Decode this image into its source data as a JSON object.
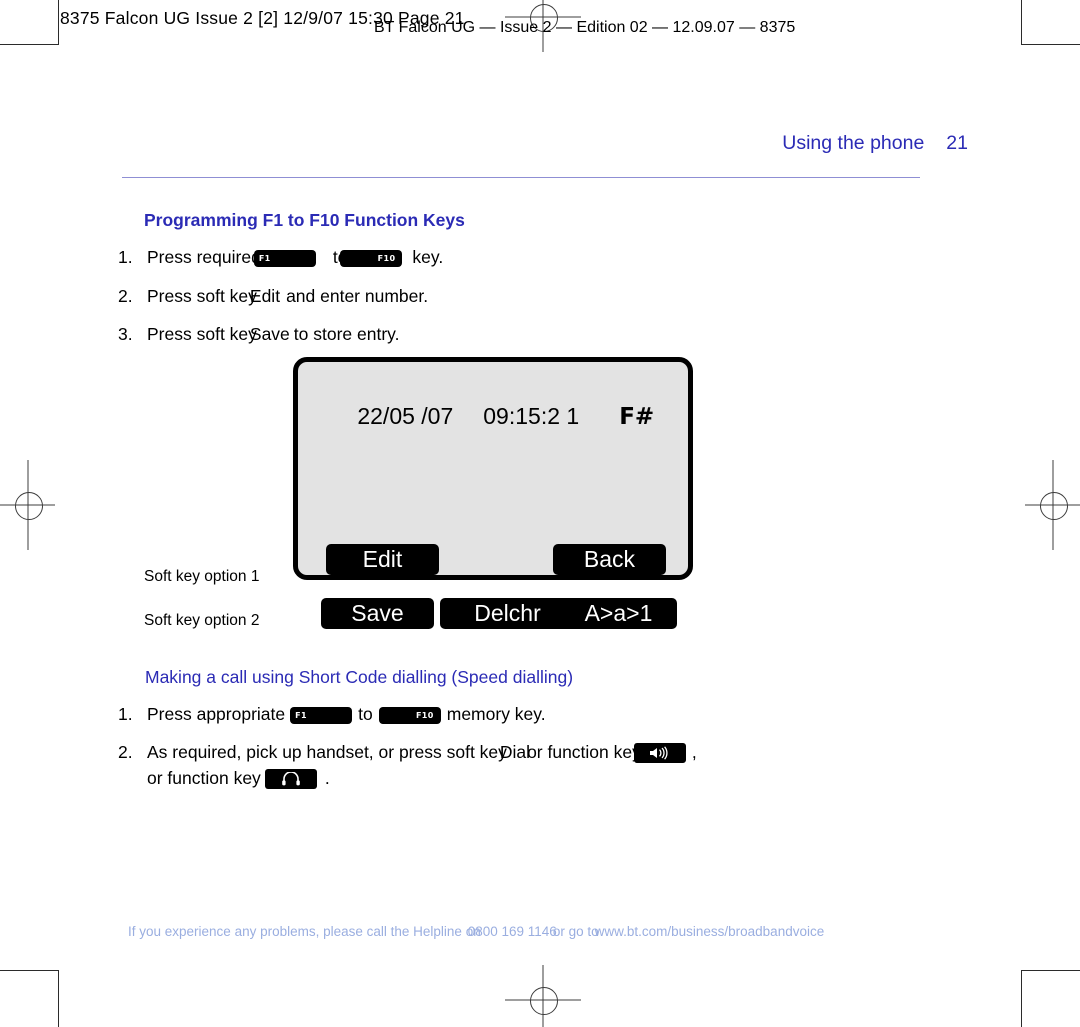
{
  "print_header": "8375 Falcon UG Issue 2 [2]  12/9/07  15:30  Page 21",
  "edition_line": "BT Falcon UG — Issue 2 — Edition 02 — 12.09.07 — 8375",
  "running_head": {
    "title": "Using the phone",
    "page_number": "21"
  },
  "headings": {
    "programming": "Programming F1 to F10 Function Keys",
    "short_code": "Making a call using Short Code dialling (Speed dialling)"
  },
  "steps_programming": [
    {
      "num": "1.",
      "text_a": "Press required",
      "key_1": "F1",
      "text_b": "to",
      "key_2": "F10",
      "text_c": "key."
    },
    {
      "num": "2.",
      "text_a": "Press soft key",
      "emph": "Edit",
      "text_b": "and enter number."
    },
    {
      "num": "3.",
      "text_a": "Press soft key",
      "emph": "Save",
      "text_b": "to store entry."
    }
  ],
  "steps_shortcode": [
    {
      "num": "1.",
      "text_a": "Press appropriate",
      "key_1": "F1",
      "text_b": "to",
      "key_2": "F10",
      "text_c": "memory key."
    },
    {
      "num": "2.",
      "text_a": "As required, pick up handset, or press soft key",
      "emph": "Dial",
      "text_b": "or function key",
      "icon_1": "loudspeaker-icon",
      "text_c": ",",
      "line2_a": "or function key",
      "icon_2": "headset-icon",
      "line2_b": "."
    }
  ],
  "phone_display": {
    "date": "22/05 /07",
    "time": "09:15:2 1",
    "flag": "F#",
    "softkeys_row1": [
      {
        "label": "Edit",
        "name": "softkey-edit"
      },
      {
        "label": "Back",
        "name": "softkey-back"
      }
    ],
    "softkeys_row2": [
      {
        "label": "Save",
        "name": "softkey-save"
      },
      {
        "label": "Delchr",
        "name": "softkey-delchr"
      },
      {
        "label": "A>a>1",
        "name": "softkey-a-a-1"
      }
    ]
  },
  "captions": {
    "soft_key_option_1": "Soft key option 1",
    "soft_key_option_2": "Soft key option 2"
  },
  "footer": {
    "part_a": "If you experience any problems, please call the Helpline on",
    "phone": "0800 169 1146",
    "part_b": "or go to",
    "url": "www.bt.com/business/broadbandvoice"
  },
  "colors": {
    "heading_blue": "#2b2bb5",
    "rule_blue": "#8f8fd4",
    "footer_blue": "#9aaee0",
    "lcd_background": "#e3e3e3",
    "key_black": "#000000"
  }
}
